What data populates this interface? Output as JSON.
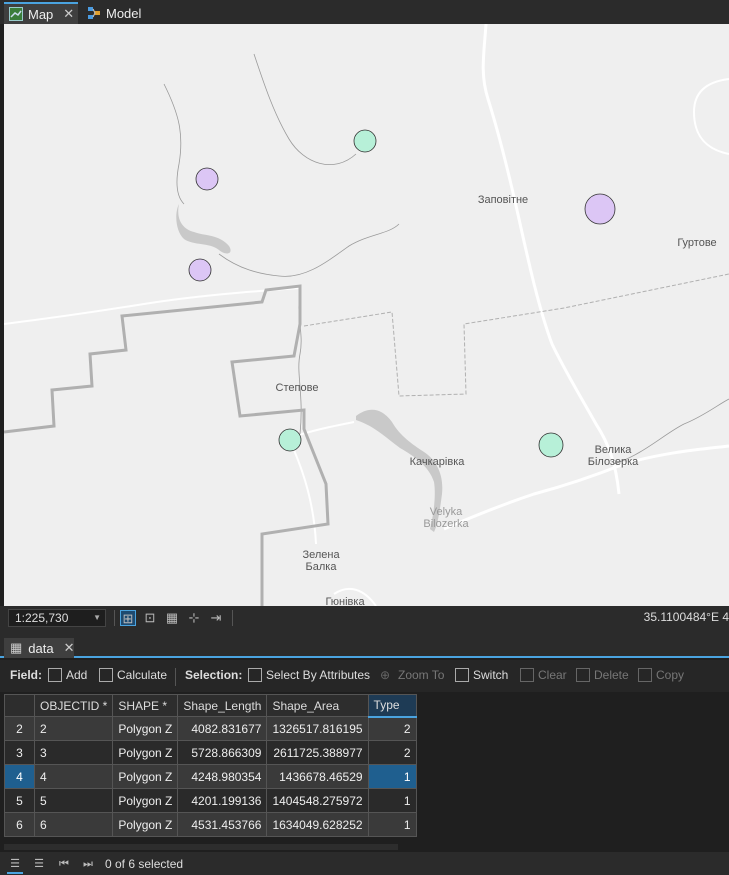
{
  "tabs": {
    "map": "Map",
    "model": "Model",
    "data": "data"
  },
  "map": {
    "labels": {
      "zapovitne": "Заповітне",
      "hurtove": "Гуртове",
      "stepove": "Степове",
      "kachkarivka": "Качкарівка",
      "velyka_1": "Велика",
      "velyka_2": "Білозерка",
      "velyka_latin_1": "Velyka",
      "velyka_latin_2": "Bilozerka",
      "zelena_1": "Зелена",
      "zelena_2": "Балка",
      "hiunivka": "Гюнівка"
    },
    "colors": {
      "type1": "#b7f0d8",
      "type2": "#dcc6f5",
      "road": "#ffffff",
      "water": "#c9c9c9",
      "border": "#b0b0b0"
    }
  },
  "status": {
    "scale": "1:225,730",
    "coordinates": "35.1100484°E 4"
  },
  "toolbar": {
    "field_label": "Field:",
    "add": "Add",
    "calculate": "Calculate",
    "selection_label": "Selection:",
    "select_by_attributes": "Select By Attributes",
    "zoom_to": "Zoom To",
    "switch": "Switch",
    "clear": "Clear",
    "delete": "Delete",
    "copy": "Copy"
  },
  "table": {
    "columns": [
      "OBJECTID *",
      "SHAPE *",
      "Shape_Length",
      "Shape_Area",
      "Type"
    ],
    "rows": [
      {
        "row": "2",
        "objectid": "2",
        "shape": "Polygon Z",
        "length": "4082.831677",
        "area": "1326517.816195",
        "type": "2"
      },
      {
        "row": "3",
        "objectid": "3",
        "shape": "Polygon Z",
        "length": "5728.866309",
        "area": "2611725.388977",
        "type": "2"
      },
      {
        "row": "4",
        "objectid": "4",
        "shape": "Polygon Z",
        "length": "4248.980354",
        "area": "1436678.46529",
        "type": "1"
      },
      {
        "row": "5",
        "objectid": "5",
        "shape": "Polygon Z",
        "length": "4201.199136",
        "area": "1404548.275972",
        "type": "1"
      },
      {
        "row": "6",
        "objectid": "6",
        "shape": "Polygon Z",
        "length": "4531.453766",
        "area": "1634049.628252",
        "type": "1"
      }
    ]
  },
  "footer": {
    "selected": "0 of 6 selected"
  }
}
